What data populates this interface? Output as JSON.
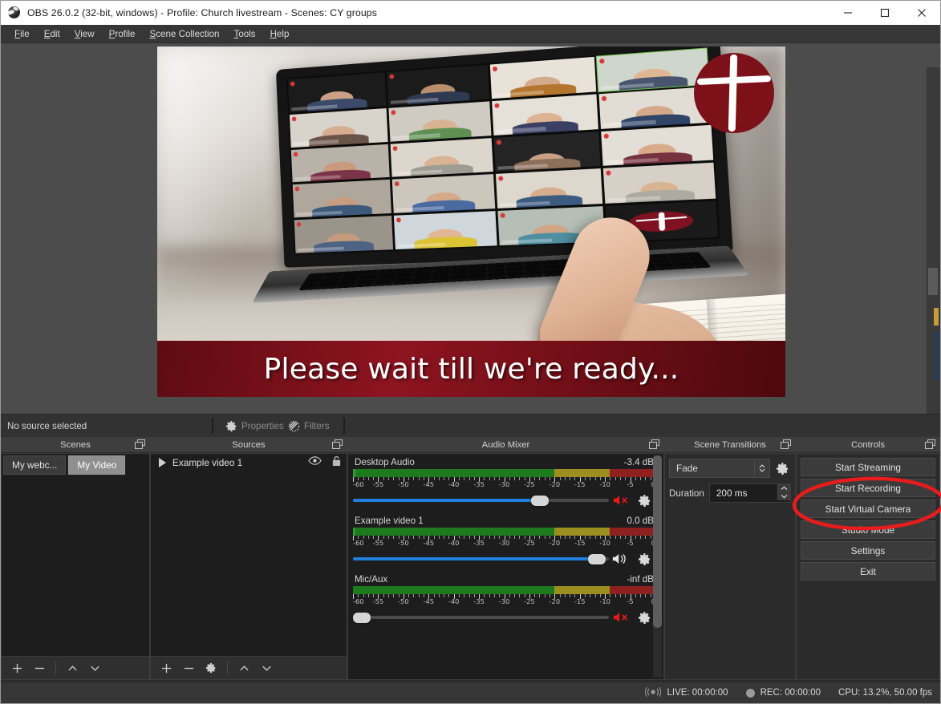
{
  "window": {
    "title": "OBS 26.0.2 (32-bit, windows) - Profile: Church livestream - Scenes: CY groups",
    "app_icon": "obs-globe-icon",
    "minimize": "minimize-icon",
    "maximize": "maximize-icon",
    "close": "close-icon"
  },
  "menubar": {
    "items": [
      {
        "label": "File",
        "accel": "F"
      },
      {
        "label": "Edit",
        "accel": "E"
      },
      {
        "label": "View",
        "accel": "V"
      },
      {
        "label": "Profile",
        "accel": "P"
      },
      {
        "label": "Scene Collection",
        "accel": "S"
      },
      {
        "label": "Tools",
        "accel": "T"
      },
      {
        "label": "Help",
        "accel": "H"
      }
    ]
  },
  "preview": {
    "lower_third_text": "Please wait till we're ready...",
    "logo": "church-cross-logo",
    "description": "Blurred photo of a laptop showing a video-call grid of participants, a hand pointing at the screen, and an open book"
  },
  "source_toolbar": {
    "status": "No source selected",
    "properties_label": "Properties",
    "filters_label": "Filters"
  },
  "scenes": {
    "title": "Scenes",
    "items": [
      {
        "label": "My webc...",
        "selected": false
      },
      {
        "label": "My Video",
        "selected": true
      }
    ],
    "footer": [
      "add-scene",
      "remove-scene",
      "move-scene-up",
      "move-scene-down"
    ]
  },
  "sources": {
    "title": "Sources",
    "items": [
      {
        "label": "Example video 1",
        "visible": true,
        "locked": false
      }
    ],
    "footer": [
      "add-source",
      "remove-source",
      "source-properties",
      "move-source-up",
      "move-source-down"
    ]
  },
  "audio_mixer": {
    "title": "Audio Mixer",
    "scale_ticks": [
      -60,
      -55,
      -50,
      -45,
      -40,
      -35,
      -30,
      -25,
      -20,
      -15,
      -10,
      -5,
      0
    ],
    "channels": [
      {
        "name": "Desktop Audio",
        "db": "-3.4 dB",
        "fader_percent": 73,
        "muted": true,
        "meter_level": 1
      },
      {
        "name": "Example video 1",
        "db": "0.0 dB",
        "fader_percent": 97,
        "muted": false,
        "meter_level": 1
      },
      {
        "name": "Mic/Aux",
        "db": "-inf dB",
        "fader_percent": 2,
        "muted": true,
        "meter_level": 0
      }
    ]
  },
  "scene_transitions": {
    "title": "Scene Transitions",
    "transition": "Fade",
    "duration_label": "Duration",
    "duration_value": "200 ms"
  },
  "controls": {
    "title": "Controls",
    "buttons": [
      "Start Streaming",
      "Start Recording",
      "Start Virtual Camera",
      "Studio Mode",
      "Settings",
      "Exit"
    ],
    "highlighted": "Start Virtual Camera",
    "highlight_color": "#e81c1c"
  },
  "statusbar": {
    "live_label": "LIVE: 00:00:00",
    "rec_label": "REC: 00:00:00",
    "cpu_label": "CPU: 13.2%, 50.00 fps"
  }
}
